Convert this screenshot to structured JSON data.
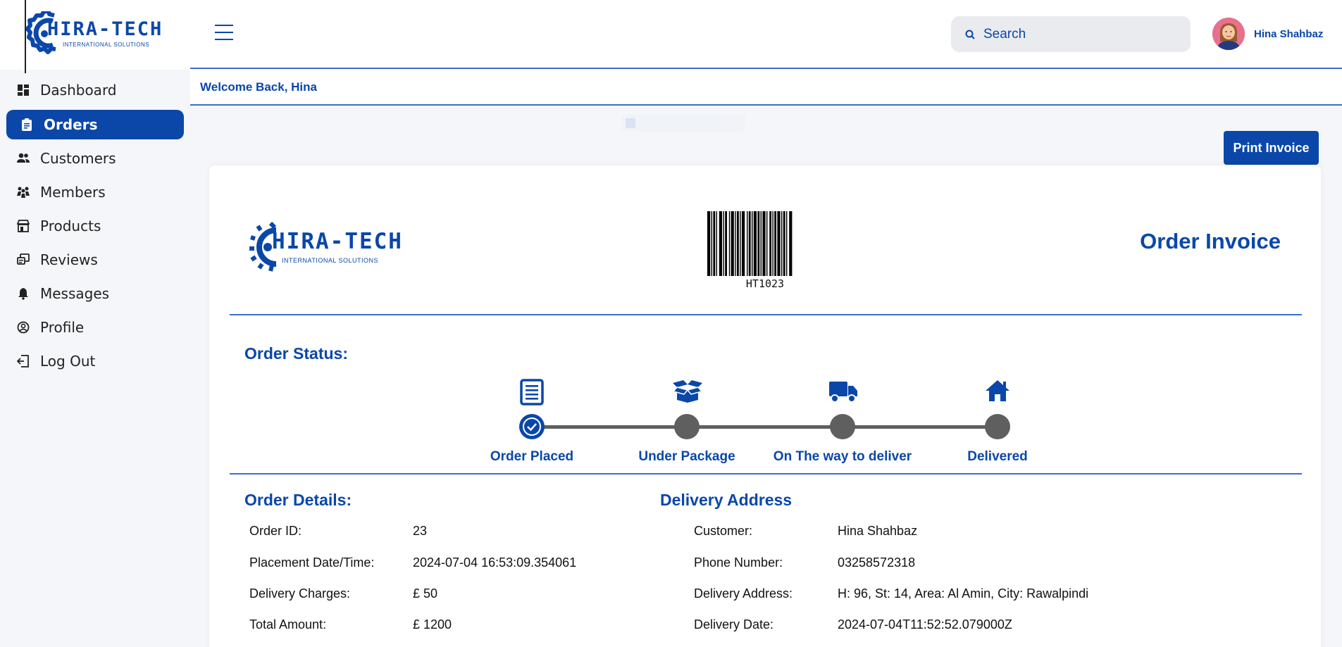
{
  "brand": {
    "name": "HIRA-TECH",
    "tagline": "INTERNATIONAL SOLUTIONS"
  },
  "sidebar": {
    "items": [
      {
        "label": "Dashboard",
        "icon": "dashboard-icon",
        "active": false
      },
      {
        "label": "Orders",
        "icon": "clipboard-icon",
        "active": true
      },
      {
        "label": "Customers",
        "icon": "people-icon",
        "active": false
      },
      {
        "label": "Members",
        "icon": "members-icon",
        "active": false
      },
      {
        "label": "Products",
        "icon": "store-icon",
        "active": false
      },
      {
        "label": "Reviews",
        "icon": "reviews-icon",
        "active": false
      },
      {
        "label": "Messages",
        "icon": "bell-icon",
        "active": false
      },
      {
        "label": "Profile",
        "icon": "user-circle-icon",
        "active": false
      },
      {
        "label": "Log Out",
        "icon": "logout-icon",
        "active": false
      }
    ]
  },
  "header": {
    "search_placeholder": "Search",
    "search_value": "",
    "user_name": "Hina Shahbaz",
    "welcome": "Welcome Back, Hina"
  },
  "actions": {
    "print_label": "Print Invoice"
  },
  "invoice": {
    "title": "Order Invoice",
    "barcode": "HT1023",
    "status_heading": "Order Status:",
    "steps": [
      {
        "label": "Order Placed",
        "icon": "document-icon",
        "done": true
      },
      {
        "label": "Under Package",
        "icon": "open-box-icon",
        "done": false
      },
      {
        "label": "On The way to deliver",
        "icon": "truck-icon",
        "done": false
      },
      {
        "label": "Delivered",
        "icon": "house-icon",
        "done": false
      }
    ],
    "details_heading": "Order Details:",
    "details": [
      {
        "label": "Order ID:",
        "value": "23"
      },
      {
        "label": "Placement Date/Time:",
        "value": "2024-07-04 16:53:09.354061"
      },
      {
        "label": "Delivery Charges:",
        "value": "£ 50"
      },
      {
        "label": "Total Amount:",
        "value": "£ 1200"
      }
    ],
    "address_heading": "Delivery Address",
    "address": [
      {
        "label": "Customer:",
        "value": "Hina Shahbaz"
      },
      {
        "label": "Phone Number:",
        "value": "03258572318"
      },
      {
        "label": "Delivery Address:",
        "value": "H: 96, St: 14, Area: Al Amin, City: Rawalpindi"
      },
      {
        "label": "Delivery Date:",
        "value": "2024-07-04T11:52:52.079000Z"
      }
    ]
  },
  "colors": {
    "primary": "#0a47a9",
    "inactive_step": "#5f5f5f",
    "divider": "#3a6fcc"
  }
}
